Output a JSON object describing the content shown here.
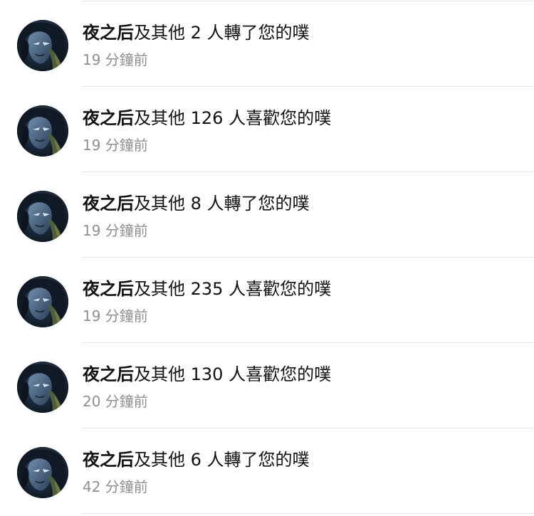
{
  "notifications": [
    {
      "name": "夜之后",
      "action": "及其他 2 人轉了您的噗",
      "time": "19 分鐘前"
    },
    {
      "name": "夜之后",
      "action": "及其他 126 人喜歡您的噗",
      "time": "19 分鐘前"
    },
    {
      "name": "夜之后",
      "action": "及其他 8 人轉了您的噗",
      "time": "19 分鐘前"
    },
    {
      "name": "夜之后",
      "action": "及其他 235 人喜歡您的噗",
      "time": "19 分鐘前"
    },
    {
      "name": "夜之后",
      "action": "及其他 130 人喜歡您的噗",
      "time": "20 分鐘前"
    },
    {
      "name": "夜之后",
      "action": "及其他 6 人轉了您的噗",
      "time": "42 分鐘前"
    }
  ],
  "colors": {
    "text": "#111111",
    "secondary_text": "#8e8e93",
    "divider": "#e4e4e6",
    "background": "#ffffff"
  }
}
